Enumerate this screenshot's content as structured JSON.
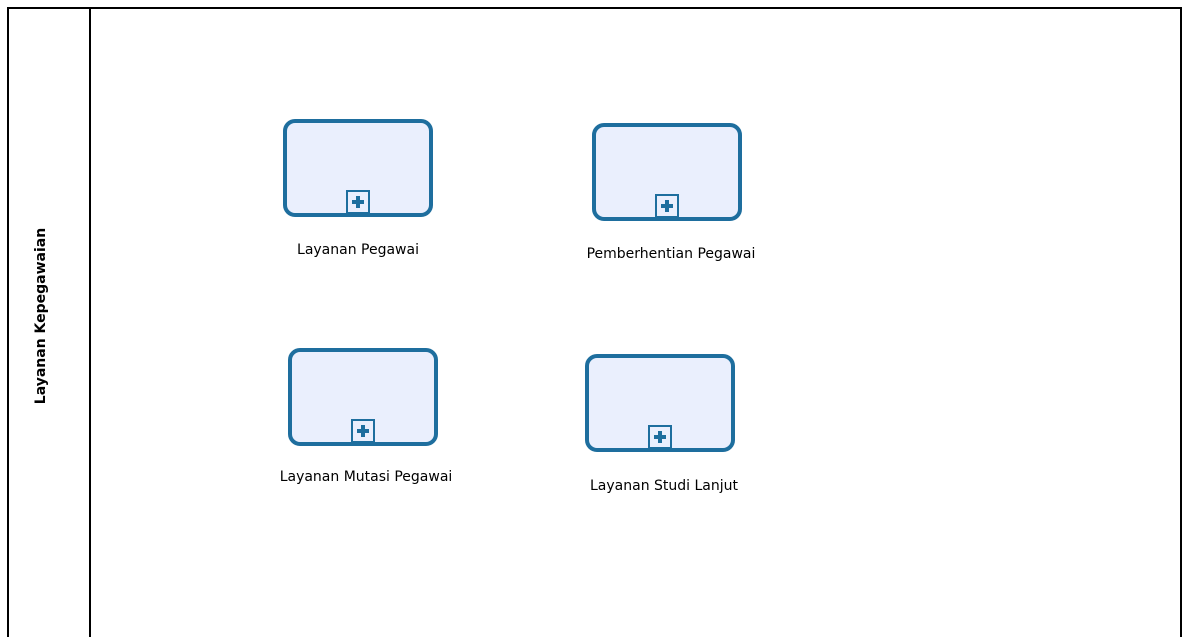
{
  "pool": {
    "label": "Layanan Kepegawaian"
  },
  "tasks": [
    {
      "label": "Layanan Pegawai"
    },
    {
      "label": "Pemberhentian Pegawai"
    },
    {
      "label": "Layanan Mutasi Pegawai"
    },
    {
      "label": "Layanan Studi Lanjut"
    }
  ],
  "colors": {
    "task_border": "#1e6e9e",
    "task_fill": "#eaeffd",
    "pool_border": "#000000"
  }
}
